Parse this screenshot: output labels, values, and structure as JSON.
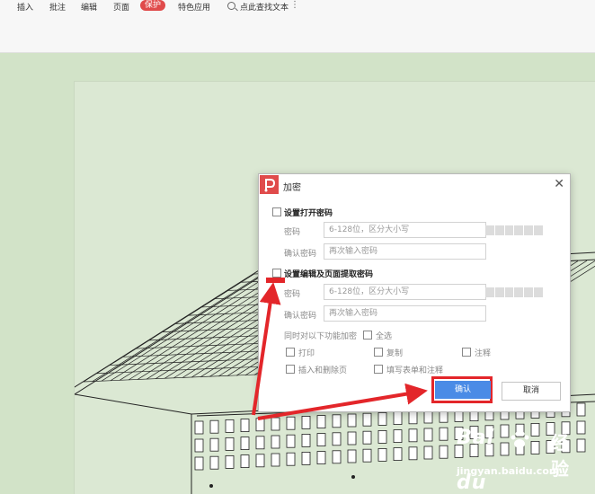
{
  "toolbar": {
    "menu": [
      {
        "label": "插入"
      },
      {
        "label": "批注"
      },
      {
        "label": "编辑"
      },
      {
        "label": "页面"
      },
      {
        "label": "保护"
      },
      {
        "label": "特色应用"
      }
    ],
    "active_menu_label": "保护",
    "search_label": "点此查找文本",
    "more_label": "⋮"
  },
  "dialog": {
    "title": "加密",
    "open_password": {
      "section_label": "设置打开密码",
      "password_label": "密码",
      "password_placeholder": "6-128位，区分大小写",
      "confirm_label": "确认密码",
      "confirm_placeholder": "再次输入密码"
    },
    "edit_password": {
      "section_label": "设置编辑及页面提取密码",
      "password_label": "密码",
      "password_placeholder": "6-128位，区分大小写",
      "confirm_label": "确认密码",
      "confirm_placeholder": "再次输入密码"
    },
    "encrypt_features_label": "同时对以下功能加密",
    "select_all_label": "全选",
    "options": [
      "打印",
      "复制",
      "注释",
      "插入和删除页",
      "填写表单和注释"
    ],
    "confirm_button": "确认",
    "cancel_button": "取消"
  },
  "watermark": {
    "brand": "Bai",
    "brand2": "du",
    "chinese": "经验",
    "url": "jingyan.baidu.com"
  },
  "colors": {
    "accent_red": "#e3262a",
    "primary_blue": "#4a8be6",
    "background_green": "#d2e3c8"
  }
}
